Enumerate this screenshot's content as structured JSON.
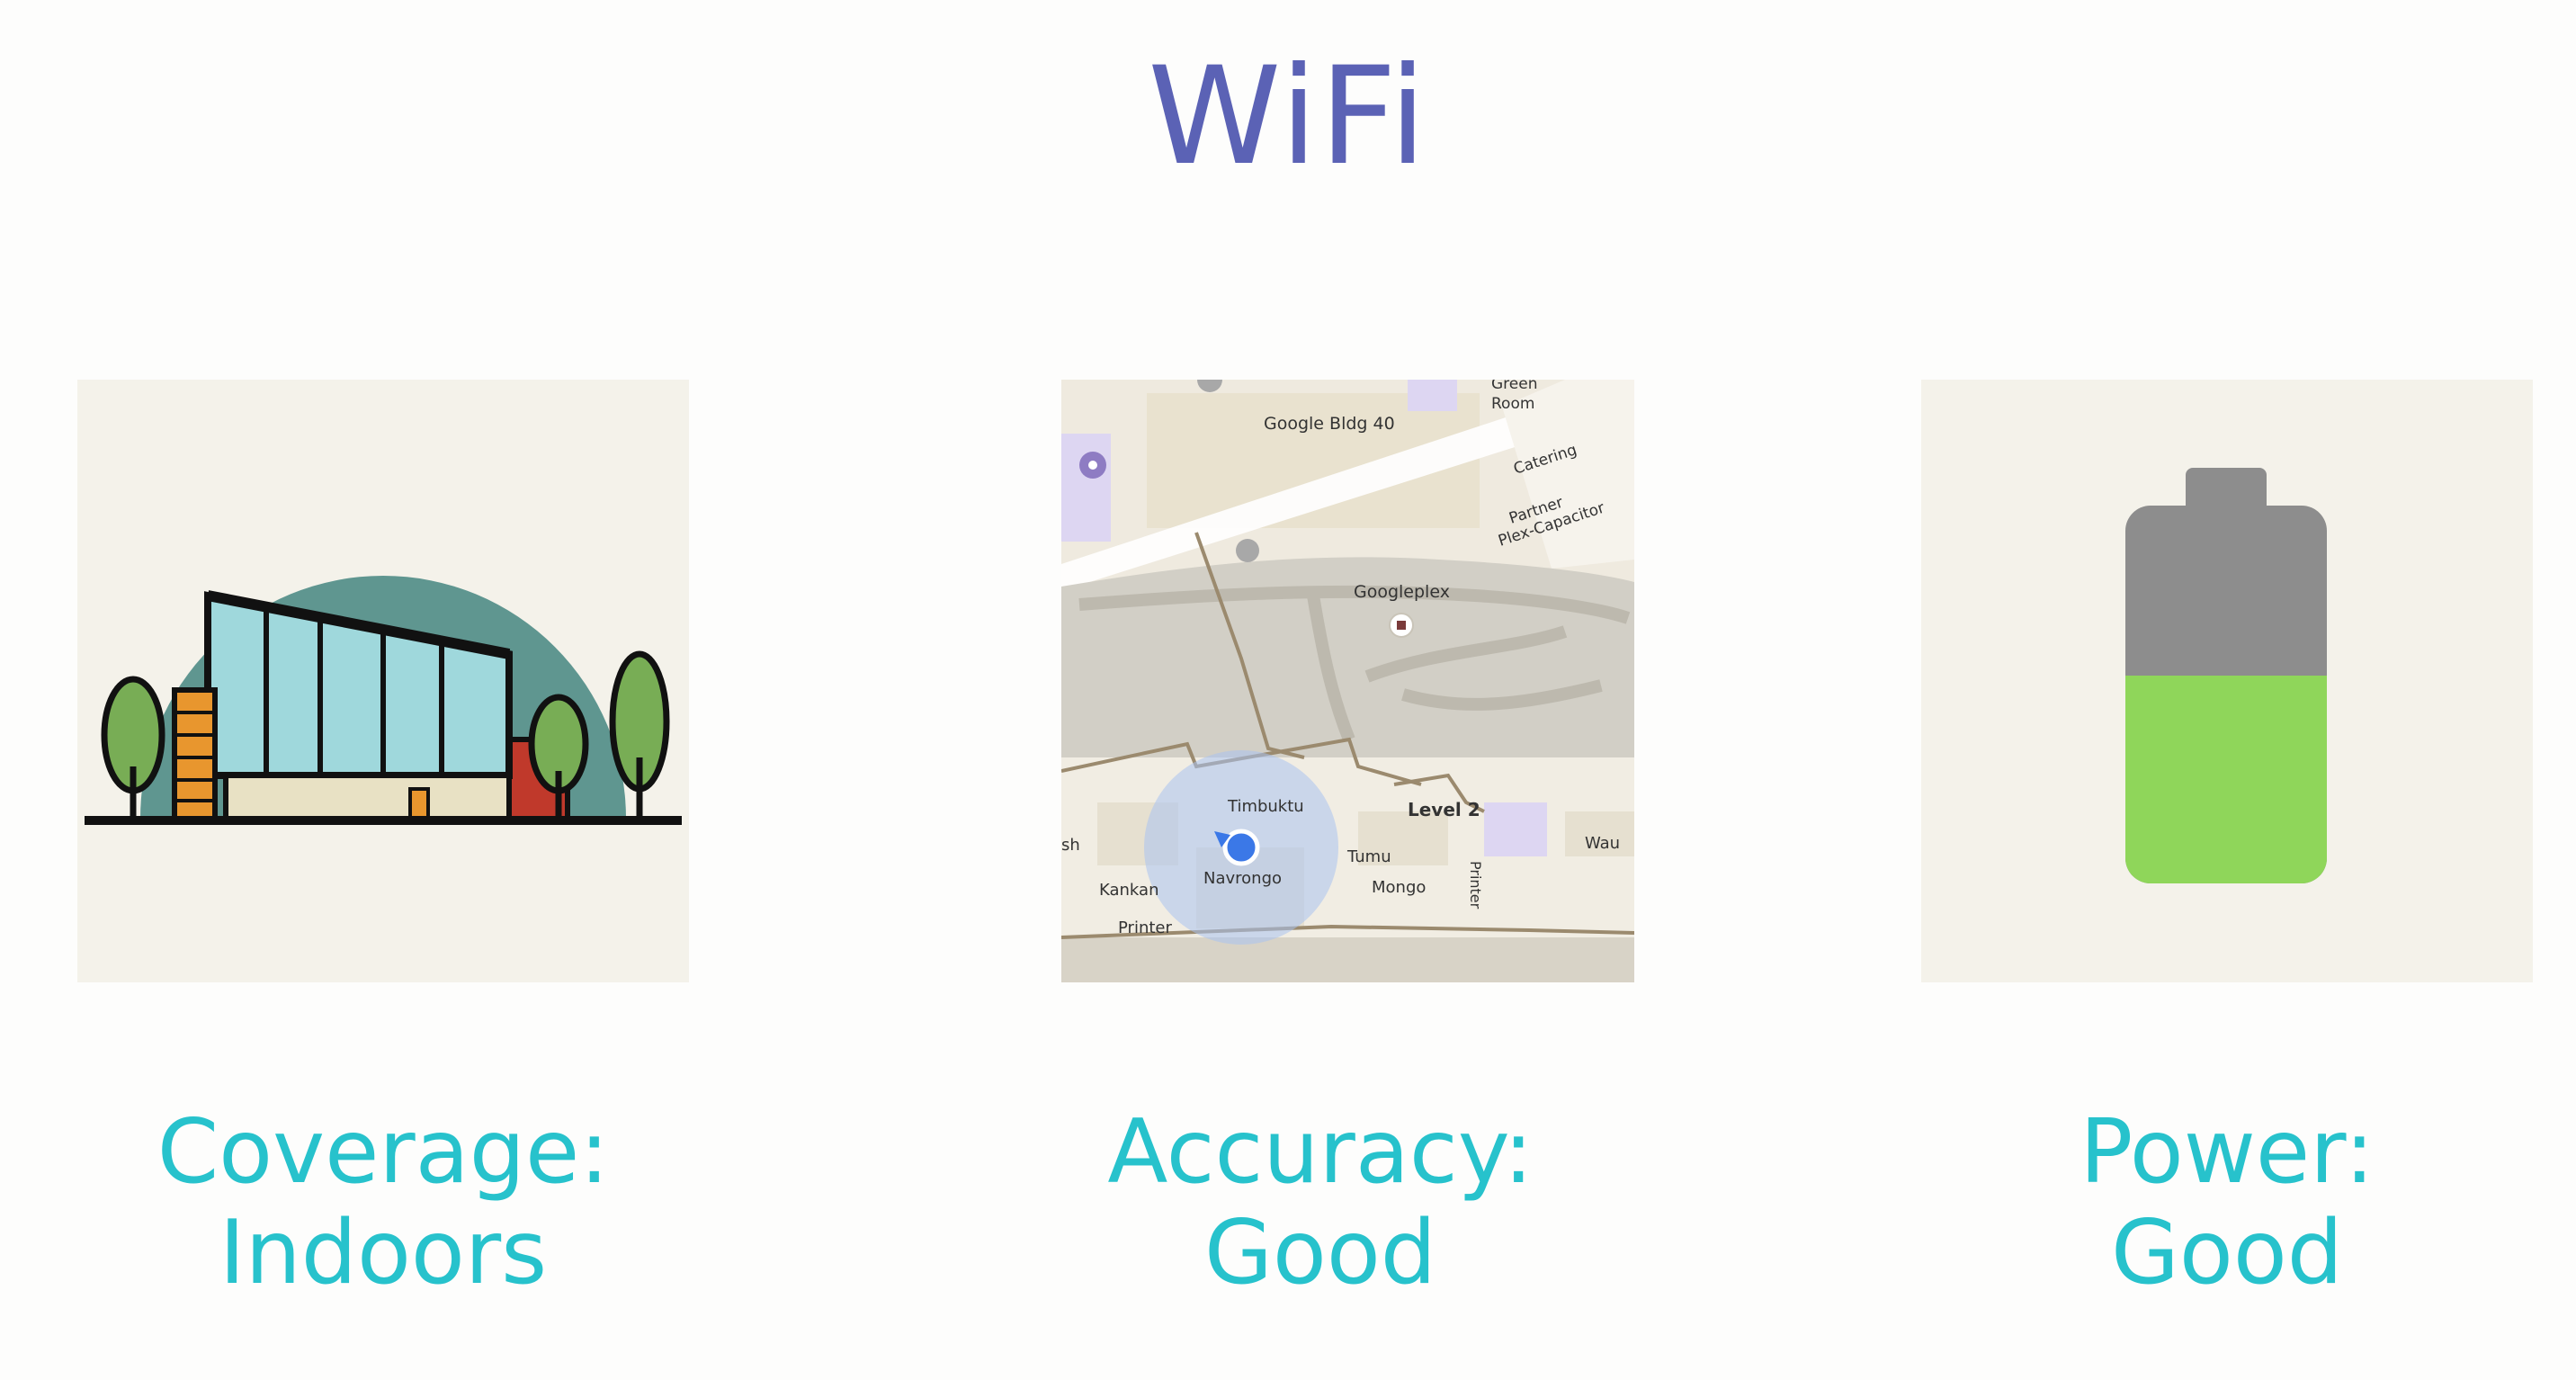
{
  "slide": {
    "title": "WiFi",
    "title_color": "#5b62b5",
    "caption_color": "#27c2cc"
  },
  "cards": [
    {
      "illustration": "building-icon",
      "caption_line1": "Coverage:",
      "caption_line2": "Indoors"
    },
    {
      "illustration": "indoor-map",
      "caption_line1": "Accuracy:",
      "caption_line2": "Good"
    },
    {
      "illustration": "battery-icon",
      "caption_line1": "Power:",
      "caption_line2": "Good",
      "battery_charge_fraction": 0.55
    }
  ],
  "map": {
    "labels": {
      "building": "Google Bldg 40",
      "green_room_1": "Green",
      "green_room_2": "Room",
      "catering": "Catering",
      "partner_1": "Partner",
      "partner_2": "Plex-Capacitor",
      "googleplex": "Googleplex",
      "level": "Level 2",
      "timbuktu": "Timbuktu",
      "navrongo": "Navrongo",
      "tumu": "Tumu",
      "mongo": "Mongo",
      "kankan": "Kankan",
      "printer_1": "Printer",
      "printer_2": "Printer",
      "wau": "Wau",
      "sh": "sh"
    }
  }
}
